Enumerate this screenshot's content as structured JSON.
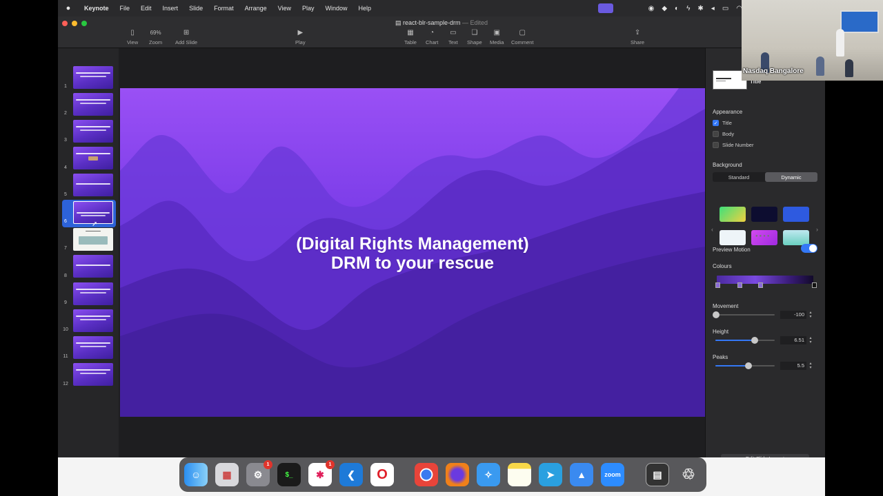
{
  "menubar": {
    "app": "Keynote",
    "items": [
      "File",
      "Edit",
      "Insert",
      "Slide",
      "Format",
      "Arrange",
      "View",
      "Play",
      "Window",
      "Help"
    ]
  },
  "document": {
    "title": "react-blr-sample-drm",
    "status": "Edited"
  },
  "toolbar": {
    "view": "View",
    "zoom_value": "69%",
    "zoom": "Zoom",
    "add_slide": "Add Slide",
    "play": "Play",
    "table": "Table",
    "chart": "Chart",
    "text": "Text",
    "shape": "Shape",
    "media": "Media",
    "comment": "Comment",
    "share": "Share"
  },
  "navigator": {
    "slides": [
      "1",
      "2",
      "3",
      "4",
      "5",
      "6",
      "7",
      "8",
      "9",
      "10",
      "11",
      "12"
    ],
    "selected": "6"
  },
  "slide": {
    "line1": "(Digital Rights Management)",
    "line2": "DRM to your rescue"
  },
  "inspector": {
    "layout_name": "Title",
    "appearance": "Appearance",
    "title_opt": "Title",
    "body_opt": "Body",
    "slide_number_opt": "Slide Number",
    "background": "Background",
    "standard": "Standard",
    "dynamic": "Dynamic",
    "preview_motion": "Preview Motion",
    "colours": "Colours",
    "movement": "Movement",
    "movement_value": "-100",
    "height": "Height",
    "height_value": "6.51",
    "peaks": "Peaks",
    "peaks_value": "5.5",
    "edit_slide_layout": "Edit Slide Layout"
  },
  "dock": {
    "settings_badge": "1",
    "slack_badge": "1",
    "zoom_label": "zoom"
  },
  "webcam": {
    "label": "Nasdaq Bangalore"
  }
}
